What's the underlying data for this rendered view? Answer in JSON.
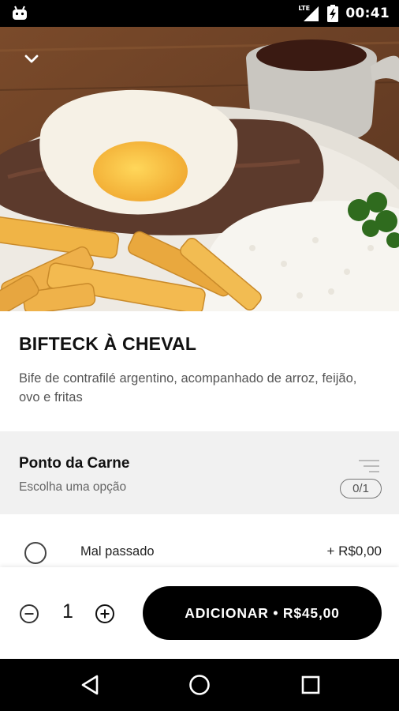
{
  "status_bar": {
    "network": "LTE",
    "time": "00:41",
    "icons": [
      "android-icon",
      "lte-signal-icon",
      "battery-charging-icon"
    ]
  },
  "header": {
    "back_icon": "chevron-down-icon"
  },
  "dish": {
    "title": "BIFTECK À CHEVAL",
    "description": "Bife de contrafilé argentino, acompanhado de arroz, feijão, ovo e fritas"
  },
  "option_group": {
    "title": "Ponto da Carne",
    "subtitle": "Escolha uma opção",
    "count": "0/1",
    "icon": "sort-lines-icon",
    "options": [
      {
        "label": "Mal passado",
        "price": "+ R$0,00",
        "selected": false
      }
    ]
  },
  "cart": {
    "quantity": "1",
    "minus_icon": "minus-circle-icon",
    "plus_icon": "plus-circle-icon",
    "add_label": "ADICIONAR • R$45,00"
  },
  "nav": {
    "icons": [
      "back-triangle-icon",
      "home-circle-icon",
      "recents-square-icon"
    ]
  },
  "colors": {
    "accent": "#000000",
    "section_bg": "#f1f1f1",
    "text_secondary": "#555555"
  }
}
